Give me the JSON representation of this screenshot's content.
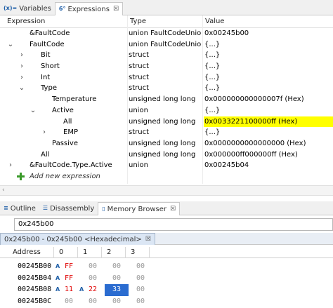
{
  "expressions_view": {
    "tabs": [
      {
        "icon": "(x)=",
        "label": "Variables",
        "active": false
      },
      {
        "icon": "6°",
        "label": "Expressions",
        "active": true,
        "close": "☒"
      }
    ],
    "columns": {
      "expression": "Expression",
      "type": "Type",
      "value": "Value"
    },
    "rows": [
      {
        "twisty": "",
        "name": "&FaultCode",
        "type": "union FaultCodeUnion",
        "value": "0x00245b00"
      },
      {
        "twisty": "⌄",
        "name": "FaultCode",
        "type": "union FaultCodeUnion",
        "value": "{...}"
      },
      {
        "twisty": "›",
        "name": "Bit",
        "type": "struct",
        "value": "{...}"
      },
      {
        "twisty": "›",
        "name": "Short",
        "type": "struct",
        "value": "{...}"
      },
      {
        "twisty": "›",
        "name": "Int",
        "type": "struct",
        "value": "{...}"
      },
      {
        "twisty": "⌄",
        "name": "Type",
        "type": "struct",
        "value": "{...}"
      },
      {
        "twisty": "",
        "name": "Temperature",
        "type": "unsigned long long",
        "value": "0x000000000000007f (Hex)"
      },
      {
        "twisty": "⌄",
        "name": "Active",
        "type": "union",
        "value": "{...}"
      },
      {
        "twisty": "",
        "name": "All",
        "type": "unsigned long long",
        "value": "0x0033221100000ff (Hex)",
        "highlight": true
      },
      {
        "twisty": "›",
        "name": "EMP",
        "type": "struct",
        "value": "{...}"
      },
      {
        "twisty": "",
        "name": "Passive",
        "type": "unsigned long long",
        "value": "0x0000000000000000 (Hex)"
      },
      {
        "twisty": "",
        "name": "All",
        "type": "unsigned long long",
        "value": "0x000000ff000000ff (Hex)"
      },
      {
        "twisty": "›",
        "name": "&FaultCode.Type.Active",
        "type": "union",
        "value": "0x00245b04"
      }
    ],
    "add_new_expression": "Add new expression"
  },
  "memory_view": {
    "tabs": [
      {
        "label": "Outline",
        "active": false
      },
      {
        "label": "Disassembly",
        "active": false
      },
      {
        "label": "Memory Browser",
        "active": true,
        "close": "☒"
      }
    ],
    "address_input": "0x245b00",
    "monitor_tab": {
      "label": "0x245b00 - 0x245b00 <Hexadecimal>",
      "close": "☒"
    },
    "columns": [
      "Address",
      "0",
      "1",
      "2",
      "3"
    ],
    "rows": [
      {
        "address": "00245B00",
        "bytes": [
          "FF",
          "00",
          "00",
          "00"
        ],
        "marks": [
          "A",
          "",
          "",
          ""
        ],
        "changed": [
          true,
          false,
          false,
          false
        ]
      },
      {
        "address": "00245B04",
        "bytes": [
          "FF",
          "00",
          "00",
          "00"
        ],
        "marks": [
          "A",
          "",
          "",
          ""
        ],
        "changed": [
          true,
          false,
          false,
          false
        ]
      },
      {
        "address": "00245B08",
        "bytes": [
          "11",
          "22",
          "33",
          "00"
        ],
        "marks": [
          "A",
          "A",
          "",
          ""
        ],
        "changed": [
          true,
          true,
          false,
          false
        ],
        "selected_index": 2
      },
      {
        "address": "00245B0C",
        "bytes": [
          "00",
          "00",
          "00",
          "00"
        ],
        "marks": [
          "",
          "",
          "",
          ""
        ],
        "changed": [
          false,
          false,
          false,
          false
        ]
      }
    ]
  },
  "colors": {
    "highlight": "#ffff00",
    "changed_byte": "#e00000",
    "selection": "#2b6cd0",
    "add_icon": "#3a9a2a"
  }
}
